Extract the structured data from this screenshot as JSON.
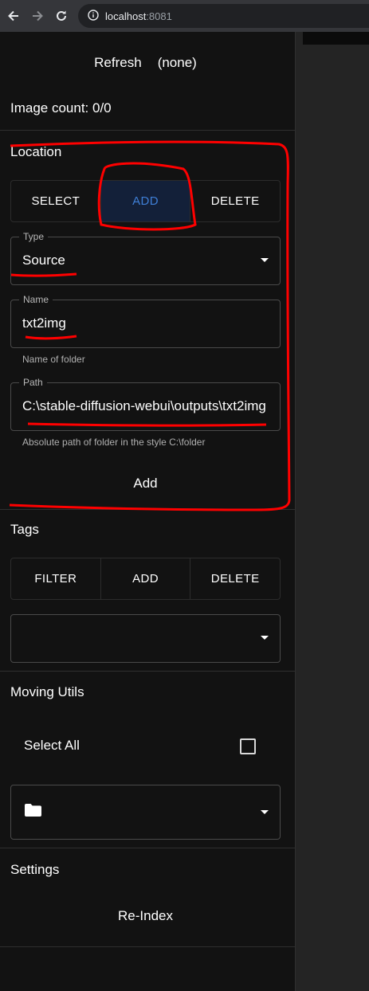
{
  "browser": {
    "host": "localhost",
    "port": ":8081"
  },
  "header": {
    "refresh_label": "Refresh",
    "selection_label": "(none)",
    "image_count": "Image count: 0/0"
  },
  "location": {
    "title": "Location",
    "modes": [
      "SELECT",
      "ADD",
      "DELETE"
    ],
    "active_mode": "ADD",
    "type": {
      "label": "Type",
      "value": "Source"
    },
    "name": {
      "label": "Name",
      "value": "txt2img",
      "helper": "Name of folder"
    },
    "path": {
      "label": "Path",
      "value": "C:\\stable-diffusion-webui\\outputs\\txt2img",
      "helper": "Absolute path of folder in the style C:\\folder"
    },
    "submit_label": "Add"
  },
  "tags": {
    "title": "Tags",
    "modes": [
      "FILTER",
      "ADD",
      "DELETE"
    ],
    "select_value": ""
  },
  "moving_utils": {
    "title": "Moving Utils",
    "select_all_label": "Select All",
    "select_all_checked": false,
    "folder_icon": "folder-icon"
  },
  "settings": {
    "title": "Settings",
    "reindex_label": "Re-Index"
  },
  "colors": {
    "sidebar_bg": "#121212",
    "active_segment_bg": "#132039",
    "active_segment_text": "#3f7fd6",
    "annotation": "#ff0000"
  }
}
